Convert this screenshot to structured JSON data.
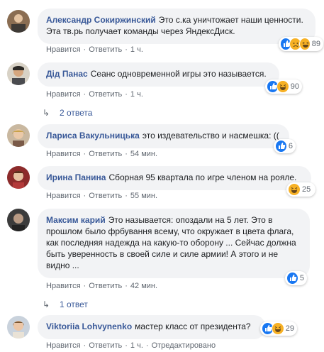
{
  "comments": [
    {
      "author": "Александр Сокиржинский",
      "text": "Это с.ка уничтожает наши ценности. Эта тв.рь получает команды через ЯндексДиск.",
      "like": "Нравится",
      "reply": "Ответить",
      "time": "1 ч.",
      "reactions": [
        "like-icon",
        "sad-icon",
        "haha-icon"
      ],
      "reaction_count": "89"
    },
    {
      "author": "Дід Панас",
      "text": "Сеанс одновременной игры это называется.",
      "like": "Нравится",
      "reply": "Ответить",
      "time": "1 ч.",
      "reactions": [
        "like-icon",
        "haha-icon"
      ],
      "reaction_count": "90",
      "replies_label": "2 ответа"
    },
    {
      "author": "Лариса Вакульницька",
      "text": "это издевательство и насмешка: ((",
      "like": "Нравится",
      "reply": "Ответить",
      "time": "54 мин.",
      "reactions": [
        "like-icon"
      ],
      "reaction_count": "6"
    },
    {
      "author": "Ирина Панина",
      "text": "Сборная 95 квартала по игре членом на рояле.",
      "like": "Нравится",
      "reply": "Ответить",
      "time": "55 мин.",
      "reactions": [
        "haha-icon"
      ],
      "reaction_count": "25"
    },
    {
      "author": "Максим карий",
      "text": "Это называется: опоздали на 5 лет. Это в прошлом было фрбування всему, что окружает в цвета флага, как последняя надежда на какую-то оборону ... Сейчас должна быть уверенность в своей силе и силе армии! А этого и не видно ...",
      "like": "Нравится",
      "reply": "Ответить",
      "time": "42 мин.",
      "reactions": [
        "like-icon"
      ],
      "reaction_count": "5",
      "replies_label": "1 ответ"
    },
    {
      "author": "Viktoriia Lohvynenko",
      "text": "мастер класс от президента?",
      "like": "Нравится",
      "reply": "Ответить",
      "time": "1 ч.",
      "edited": "Отредактировано",
      "reactions": [
        "like-icon",
        "haha-icon"
      ],
      "reaction_count": "29"
    }
  ],
  "colors": {
    "author": "#385898",
    "bubble": "#f2f3f5",
    "meta": "#606770",
    "like": "#1877f2",
    "haha": "#f7b125"
  }
}
